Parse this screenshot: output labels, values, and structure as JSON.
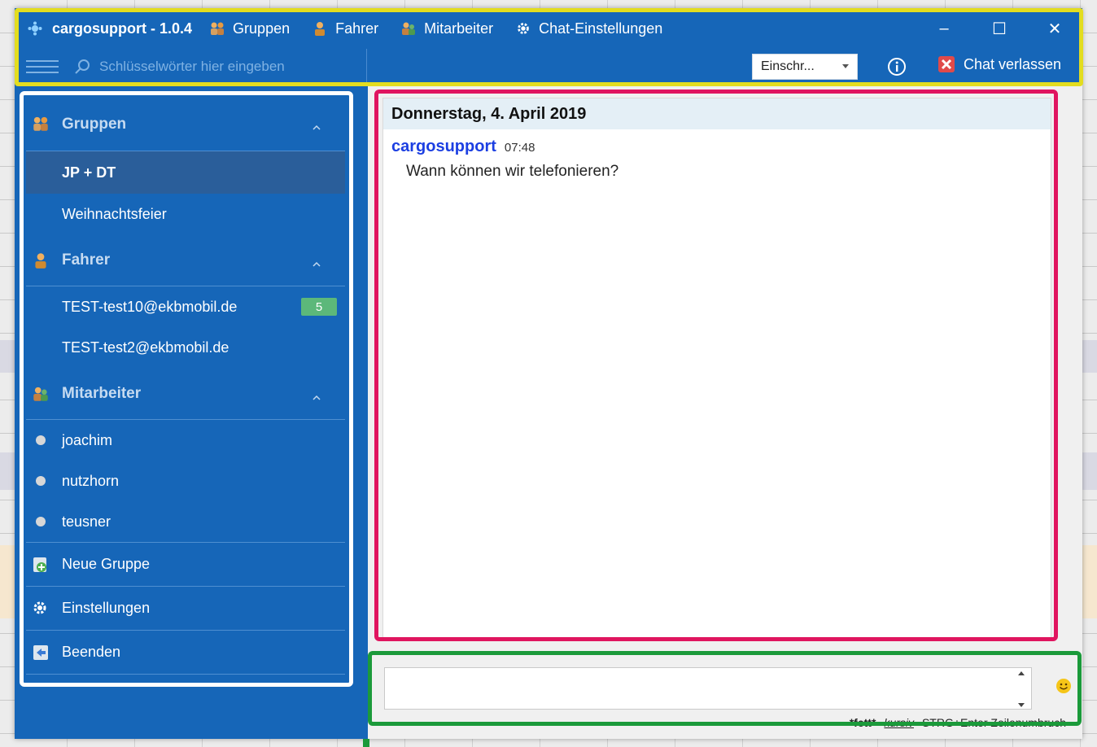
{
  "window": {
    "app_title": "cargosupport - 1.0.4",
    "menu": [
      {
        "label": "Gruppen",
        "icon": "group-icon"
      },
      {
        "label": "Fahrer",
        "icon": "driver-icon"
      },
      {
        "label": "Mitarbeiter",
        "icon": "employee-icon"
      },
      {
        "label": "Chat-Einstellungen",
        "icon": "gear-icon"
      }
    ],
    "controls": {
      "minimize": "–",
      "maximize": "☐",
      "close": "✕"
    }
  },
  "toolbar": {
    "search_placeholder": "Schlüsselwörter hier eingeben",
    "dropdown_value": "Einschr...",
    "leave_label": "Chat verlassen"
  },
  "sidebar": {
    "groups_header": "Gruppen",
    "groups": [
      "JP + DT",
      "Weihnachtsfeier"
    ],
    "drivers_header": "Fahrer",
    "drivers": [
      {
        "label": "TEST-test10@ekbmobil.de",
        "badge": "5"
      },
      {
        "label": "TEST-test2@ekbmobil.de"
      }
    ],
    "employees_header": "Mitarbeiter",
    "employees": [
      "joachim",
      "nutzhorn",
      "teusner"
    ],
    "actions": {
      "new_group": "Neue Gruppe",
      "settings": "Einstellungen",
      "quit": "Beenden"
    }
  },
  "chat": {
    "day": "Donnerstag, 4. April 2019",
    "messages": [
      {
        "author": "cargosupport",
        "time": "07:48",
        "text": "Wann können wir telefonieren?"
      }
    ],
    "composer": {
      "value": "",
      "hint_bold": "*fett*",
      "hint_italic": "kursiv",
      "hint_break": "STRG+Enter Zeilenumbruch"
    }
  },
  "colors": {
    "app_blue": "#1666b8",
    "highlight_yellow": "#e3dd1f",
    "highlight_pink": "#e0155f",
    "highlight_green": "#1b9a3a",
    "badge_green": "#5cb87a",
    "author_blue": "#1c3fe2"
  }
}
